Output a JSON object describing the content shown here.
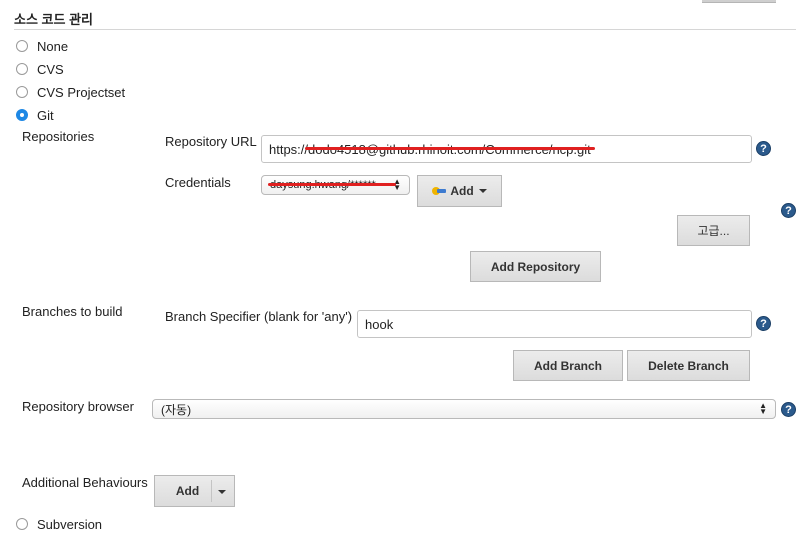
{
  "section": {
    "title": "소스 코드 관리"
  },
  "scm_options": [
    {
      "label": "None",
      "checked": false
    },
    {
      "label": "CVS",
      "checked": false
    },
    {
      "label": "CVS Projectset",
      "checked": false
    },
    {
      "label": "Git",
      "checked": true
    }
  ],
  "repositories": {
    "label": "Repositories",
    "url_label": "Repository URL",
    "url_value": "https://dodo4518@github.rhinoit.com/Commerce/ncp.git",
    "credentials_label": "Credentials",
    "credentials_value": "daysung.hwang/******",
    "add_label": "Add",
    "advanced_label": "고급...",
    "add_repository_label": "Add Repository"
  },
  "branches": {
    "label": "Branches to build",
    "specifier_label": "Branch Specifier (blank for 'any')",
    "specifier_value": "hook",
    "add_branch_label": "Add Branch",
    "delete_branch_label": "Delete Branch"
  },
  "repo_browser": {
    "label": "Repository browser",
    "selected": "(자동)"
  },
  "additional": {
    "label": "Additional Behaviours",
    "add_label": "Add"
  },
  "subversion": {
    "label": "Subversion",
    "checked": false
  },
  "help_glyph": "?",
  "colors": {
    "accent": "#1e88e5",
    "redaction": "#e02020",
    "help": "#2b5a8c"
  }
}
